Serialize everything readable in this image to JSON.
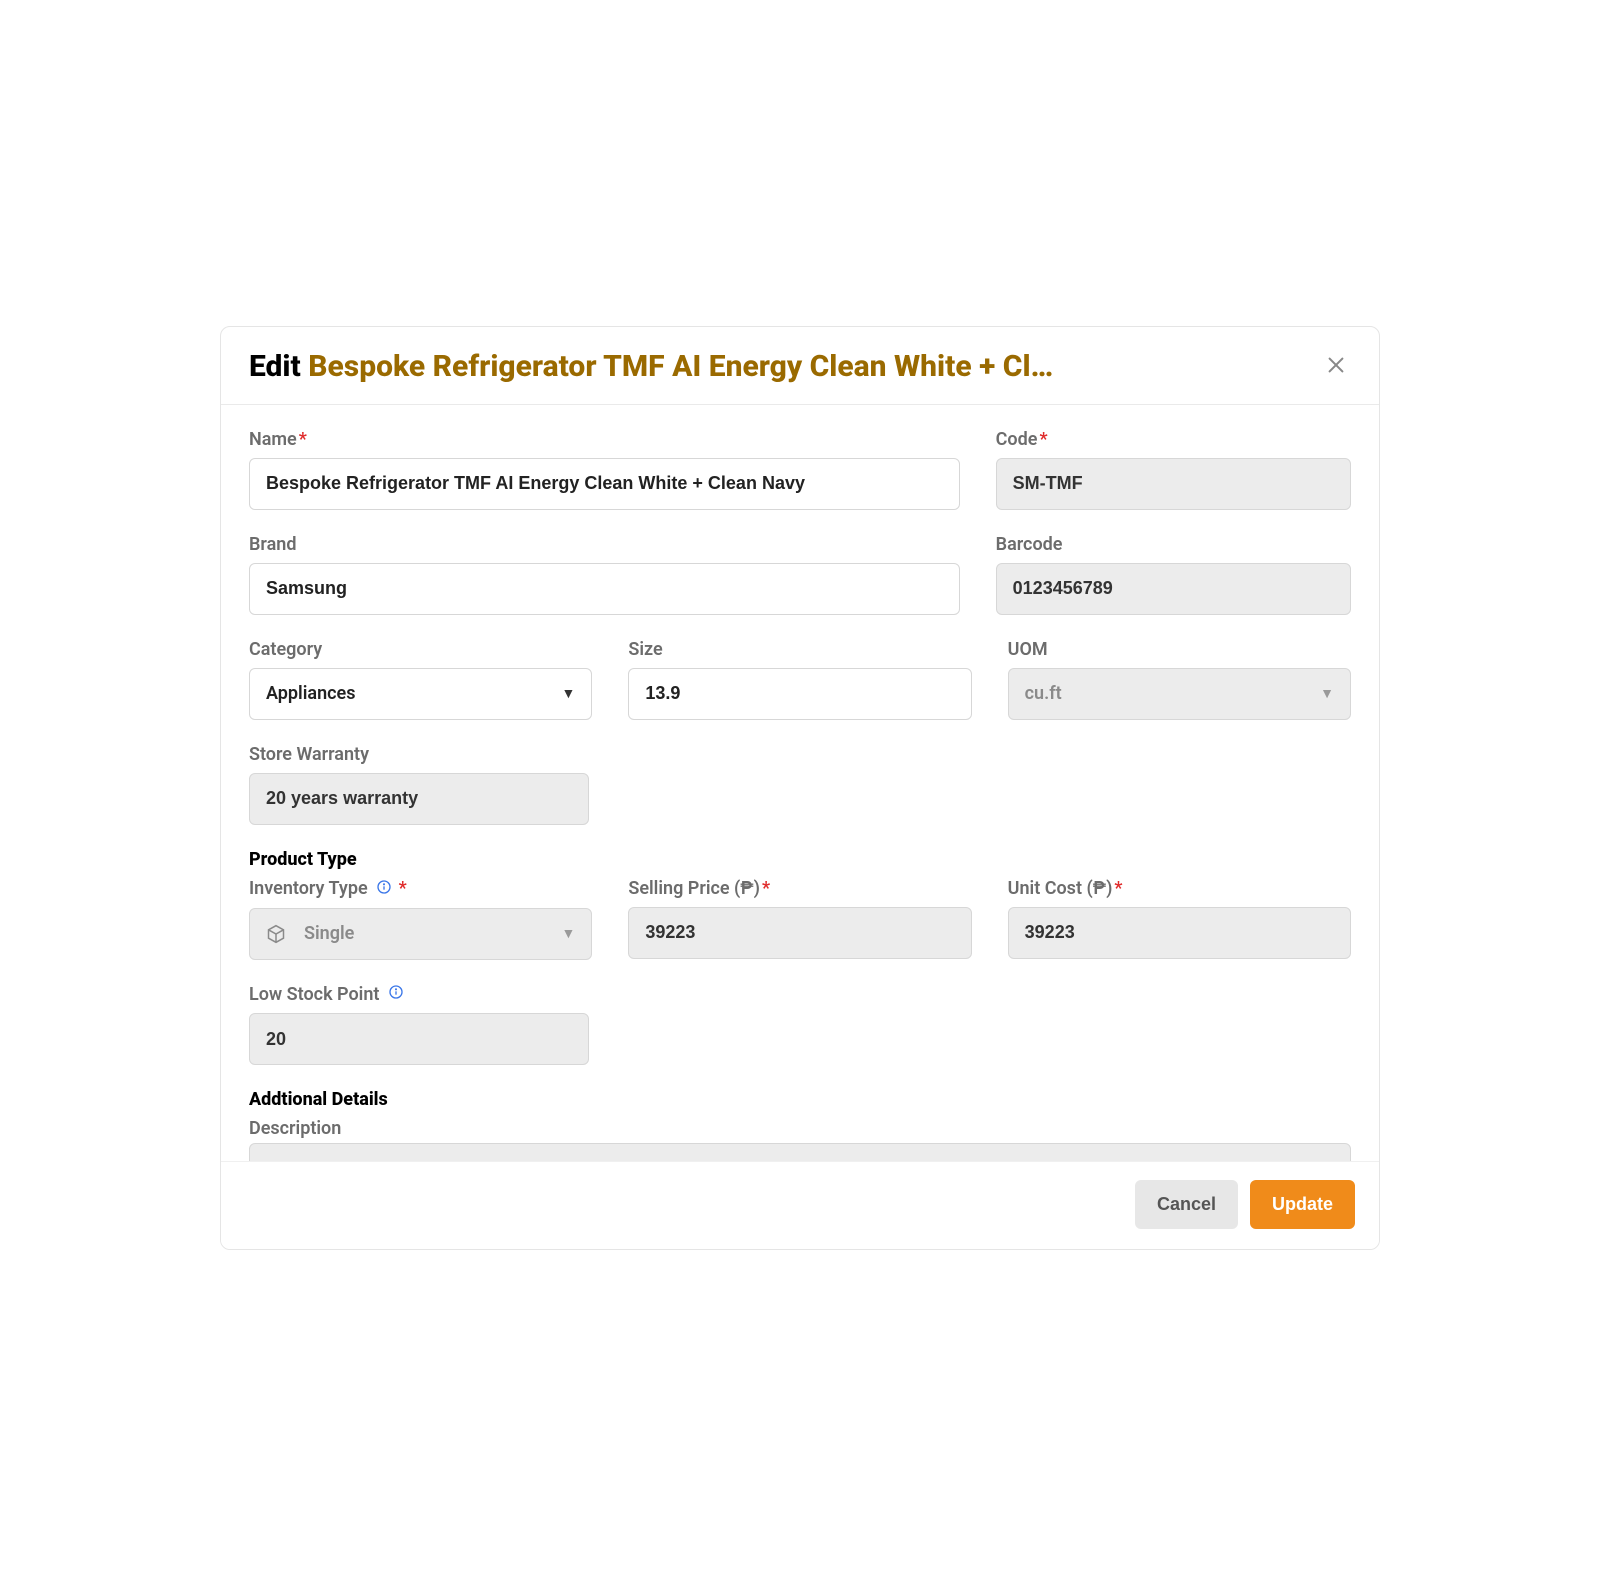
{
  "header": {
    "title_prefix": "Edit",
    "title_item_display": "Bespoke Refrigerator TMF AI Energy Clean White + Cl…",
    "title_item_full": "Bespoke Refrigerator TMF AI Energy Clean White + Clean Navy"
  },
  "labels": {
    "name": "Name",
    "code": "Code",
    "brand": "Brand",
    "barcode": "Barcode",
    "category": "Category",
    "size": "Size",
    "uom": "UOM",
    "store_warranty": "Store Warranty",
    "product_type": "Product Type",
    "inventory_type": "Inventory Type",
    "selling_price": "Selling Price (₱)",
    "unit_cost": "Unit Cost (₱)",
    "low_stock_point": "Low Stock Point",
    "additional_details": "Addtional Details",
    "description": "Description"
  },
  "values": {
    "name": "Bespoke Refrigerator TMF AI Energy Clean White + Clean Navy",
    "code": "SM-TMF",
    "brand": "Samsung",
    "barcode": "0123456789",
    "category": "Appliances",
    "size": "13.9",
    "uom": "cu.ft",
    "store_warranty": "20 years warranty",
    "inventory_type": "Single",
    "selling_price": "39223",
    "unit_cost": "39223",
    "low_stock_point": "20"
  },
  "footer": {
    "cancel": "Cancel",
    "update": "Update"
  },
  "icons": {
    "close": "close-icon",
    "info": "info-icon",
    "caret": "caret-down-icon",
    "package": "package-icon"
  }
}
